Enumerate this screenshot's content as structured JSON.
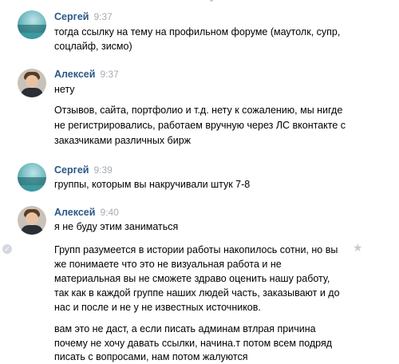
{
  "messages": [
    {
      "author": "Сергей",
      "time": "9:37",
      "lines": [
        "тогда ссылку на тему на профильном форуме (маутолк, супр,",
        "соцлайф, зисмо)"
      ]
    },
    {
      "author": "Алексей",
      "time": "9:37",
      "lines": [
        "нету"
      ],
      "lines2": [
        "Отзывов, сайта, портфолио и т.д. нету к сожалению, мы нигде",
        "не регистрировались, работаем вручную через ЛС вконтакте с",
        "заказчиками различных бирж"
      ]
    },
    {
      "author": "Сергей",
      "time": "9:39",
      "lines": [
        "группы, которым вы накручивали штук 7-8"
      ]
    },
    {
      "author": "Алексей",
      "time": "9:40",
      "lines": [
        "я не буду этим заниматься"
      ],
      "lines2": [
        "Групп разумеется в истории работы накопилось сотни, но вы",
        "же понимаете что это не визуальная работа и не",
        "материальная вы не сможете здраво оценить нашу работу,",
        "так как в каждой группе наших людей часть, заказывают и до",
        "нас и после и не у не известных источников."
      ],
      "lines3": [
        "вам это не даст, а если писать админам втлрая причина",
        "почему не хочу давать ссылки, начина.т потом всем подряд",
        "писать с вопросами, нам потом жалуются"
      ]
    }
  ],
  "icons": {
    "read_check": "check-icon",
    "favorite": "star-icon"
  }
}
